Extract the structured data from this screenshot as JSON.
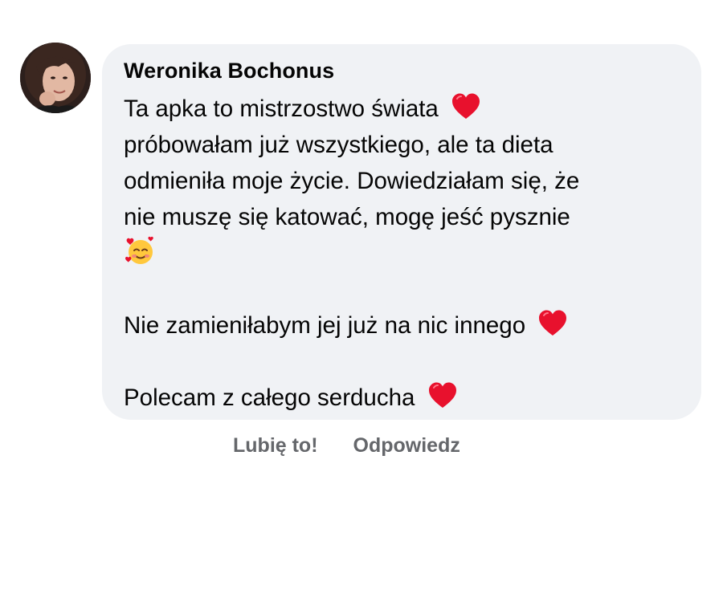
{
  "comment": {
    "author": "Weronika Bochonus",
    "avatar_icon": "profile-photo",
    "lines": [
      "Ta apka to mistrzostwo świata",
      "próbowałam już wszystkiego, ale ta dieta",
      "odmieniła moje życie. Dowiedziałam się, że",
      "nie muszę się katować, mogę jeść pysznie",
      "",
      "",
      "Nie zamieniłabym jej już na nic innego",
      "",
      "Polecam z całego serducha"
    ],
    "emojis": {
      "heart": "red-heart-icon",
      "smile": "smiling-face-with-hearts-icon"
    }
  },
  "actions": {
    "like_label": "Lubię to!",
    "reply_label": "Odpowiedz"
  },
  "colors": {
    "bubble_bg": "#f0f2f5",
    "text": "#050505",
    "action_text": "#65676b",
    "heart": "#e8112d"
  }
}
